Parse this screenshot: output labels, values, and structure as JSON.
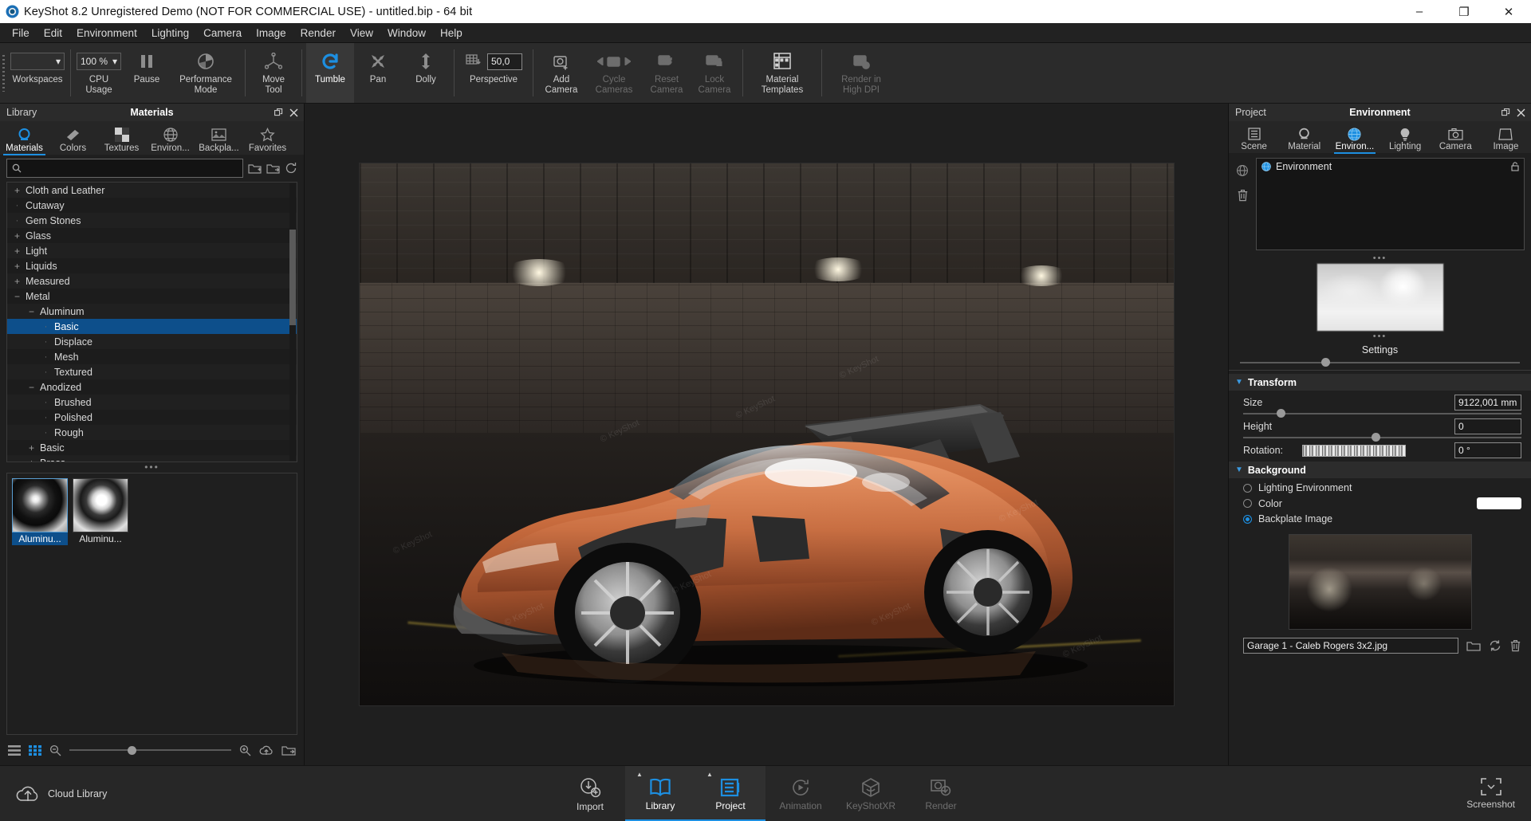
{
  "window": {
    "title": "KeyShot 8.2 Unregistered Demo (NOT FOR COMMERCIAL USE) - untitled.bip  - 64 bit",
    "minimize": "–",
    "maximize": "❐",
    "close": "✕"
  },
  "menu": [
    "File",
    "Edit",
    "Environment",
    "Lighting",
    "Camera",
    "Image",
    "Render",
    "View",
    "Window",
    "Help"
  ],
  "toolbar": {
    "workspaces": {
      "label": "Workspaces",
      "value": ""
    },
    "cpu_usage": {
      "label": "CPU Usage",
      "value": "100 %"
    },
    "pause": {
      "label": "Pause"
    },
    "performance_mode": {
      "label": "Performance\nMode",
      "line1": "Performance",
      "line2": "Mode"
    },
    "move_tool": {
      "line1": "Move",
      "line2": "Tool"
    },
    "tumble": {
      "label": "Tumble"
    },
    "pan": {
      "label": "Pan"
    },
    "dolly": {
      "label": "Dolly"
    },
    "perspective": {
      "label": "Perspective",
      "value": "50,0"
    },
    "add_camera": {
      "line1": "Add",
      "line2": "Camera"
    },
    "cycle_cameras": {
      "line1": "Cycle",
      "line2": "Cameras"
    },
    "reset_camera": {
      "line1": "Reset",
      "line2": "Camera"
    },
    "lock_camera": {
      "line1": "Lock",
      "line2": "Camera"
    },
    "material_templates": {
      "line1": "Material",
      "line2": "Templates"
    },
    "render_high_dpi": {
      "line1": "Render in",
      "line2": "High DPI"
    }
  },
  "library": {
    "panel_left_label": "Library",
    "panel_title": "Materials",
    "tabs": [
      {
        "label": "Materials",
        "icon": "material-ball-icon"
      },
      {
        "label": "Colors",
        "icon": "color-swatch-icon"
      },
      {
        "label": "Textures",
        "icon": "checker-icon"
      },
      {
        "label": "Environ...",
        "icon": "globe-icon"
      },
      {
        "label": "Backpla...",
        "icon": "image-icon"
      },
      {
        "label": "Favorites",
        "icon": "star-icon"
      }
    ],
    "selected_tab": "Materials",
    "search_placeholder": "",
    "search_value": "",
    "tree": [
      {
        "label": "Cloth and Leather",
        "indent": 0,
        "toggle": "+"
      },
      {
        "label": "Cutaway",
        "indent": 0,
        "toggle": ""
      },
      {
        "label": "Gem Stones",
        "indent": 0,
        "toggle": ""
      },
      {
        "label": "Glass",
        "indent": 0,
        "toggle": "+"
      },
      {
        "label": "Light",
        "indent": 0,
        "toggle": "+"
      },
      {
        "label": "Liquids",
        "indent": 0,
        "toggle": "+"
      },
      {
        "label": "Measured",
        "indent": 0,
        "toggle": "+"
      },
      {
        "label": "Metal",
        "indent": 0,
        "toggle": "−"
      },
      {
        "label": "Aluminum",
        "indent": 1,
        "toggle": "−"
      },
      {
        "label": "Basic",
        "indent": 2,
        "toggle": "",
        "selected": true
      },
      {
        "label": "Displace",
        "indent": 2,
        "toggle": ""
      },
      {
        "label": "Mesh",
        "indent": 2,
        "toggle": ""
      },
      {
        "label": "Textured",
        "indent": 2,
        "toggle": ""
      },
      {
        "label": "Anodized",
        "indent": 1,
        "toggle": "−"
      },
      {
        "label": "Brushed",
        "indent": 2,
        "toggle": ""
      },
      {
        "label": "Polished",
        "indent": 2,
        "toggle": ""
      },
      {
        "label": "Rough",
        "indent": 2,
        "toggle": ""
      },
      {
        "label": "Basic",
        "indent": 1,
        "toggle": "+"
      },
      {
        "label": "Brass",
        "indent": 1,
        "toggle": "+"
      }
    ],
    "thumbnails": [
      {
        "caption": "Aluminu...",
        "selected": true
      },
      {
        "caption": "Aluminu...",
        "selected": false
      }
    ],
    "footer": {
      "list_view": "list-view-icon",
      "grid_view": "grid-view-icon",
      "zoom_out": "zoom-out-icon",
      "zoom_in": "zoom-in-icon",
      "upload": "cloud-upload-icon",
      "folder": "open-folder-icon"
    }
  },
  "project": {
    "panel_left_label": "Project",
    "panel_title": "Environment",
    "tabs": [
      {
        "label": "Scene",
        "icon": "scene-list-icon"
      },
      {
        "label": "Material",
        "icon": "material-ball-icon"
      },
      {
        "label": "Environ...",
        "icon": "globe-icon"
      },
      {
        "label": "Lighting",
        "icon": "bulb-icon"
      },
      {
        "label": "Camera",
        "icon": "camera-icon"
      },
      {
        "label": "Image",
        "icon": "frame-icon"
      }
    ],
    "selected_tab": "Environ...",
    "env_list": [
      {
        "label": "Environment"
      }
    ],
    "preview_label": "Settings",
    "transform": {
      "title": "Transform",
      "size_label": "Size",
      "size_value": "9122,001 mm",
      "height_label": "Height",
      "height_value": "0",
      "rotation_label": "Rotation:",
      "rotation_value": "0 °"
    },
    "background": {
      "title": "Background",
      "options": [
        {
          "label": "Lighting Environment",
          "selected": false
        },
        {
          "label": "Color",
          "selected": false,
          "swatch": "#ffffff"
        },
        {
          "label": "Backplate Image",
          "selected": true
        }
      ],
      "backplate_file": "Garage 1 -  Caleb Rogers 3x2.jpg"
    }
  },
  "bottom": {
    "cloud_library": "Cloud Library",
    "items": [
      {
        "label": "Import",
        "icon": "import-icon",
        "state": "normal"
      },
      {
        "label": "Library",
        "icon": "book-icon",
        "state": "selected"
      },
      {
        "label": "Project",
        "icon": "project-icon",
        "state": "selected"
      },
      {
        "label": "Animation",
        "icon": "animation-icon",
        "state": "disabled"
      },
      {
        "label": "KeyShotXR",
        "icon": "keyshotxr-icon",
        "state": "disabled"
      },
      {
        "label": "Render",
        "icon": "render-icon",
        "state": "disabled"
      }
    ],
    "screenshot": "Screenshot"
  },
  "viewport": {
    "watermarks": [
      "© KeyShot",
      "© KeyShot",
      "© KeyShot",
      "© KeyShot",
      "© KeyShot",
      "© KeyShot",
      "© KeyShot",
      "© KeyShot",
      "© KeyShot"
    ]
  },
  "colors": {
    "accent": "#1d8fe1",
    "selection": "#0d4f8b",
    "panel": "#1f1f1f",
    "toolbar": "#2b2b2b"
  }
}
